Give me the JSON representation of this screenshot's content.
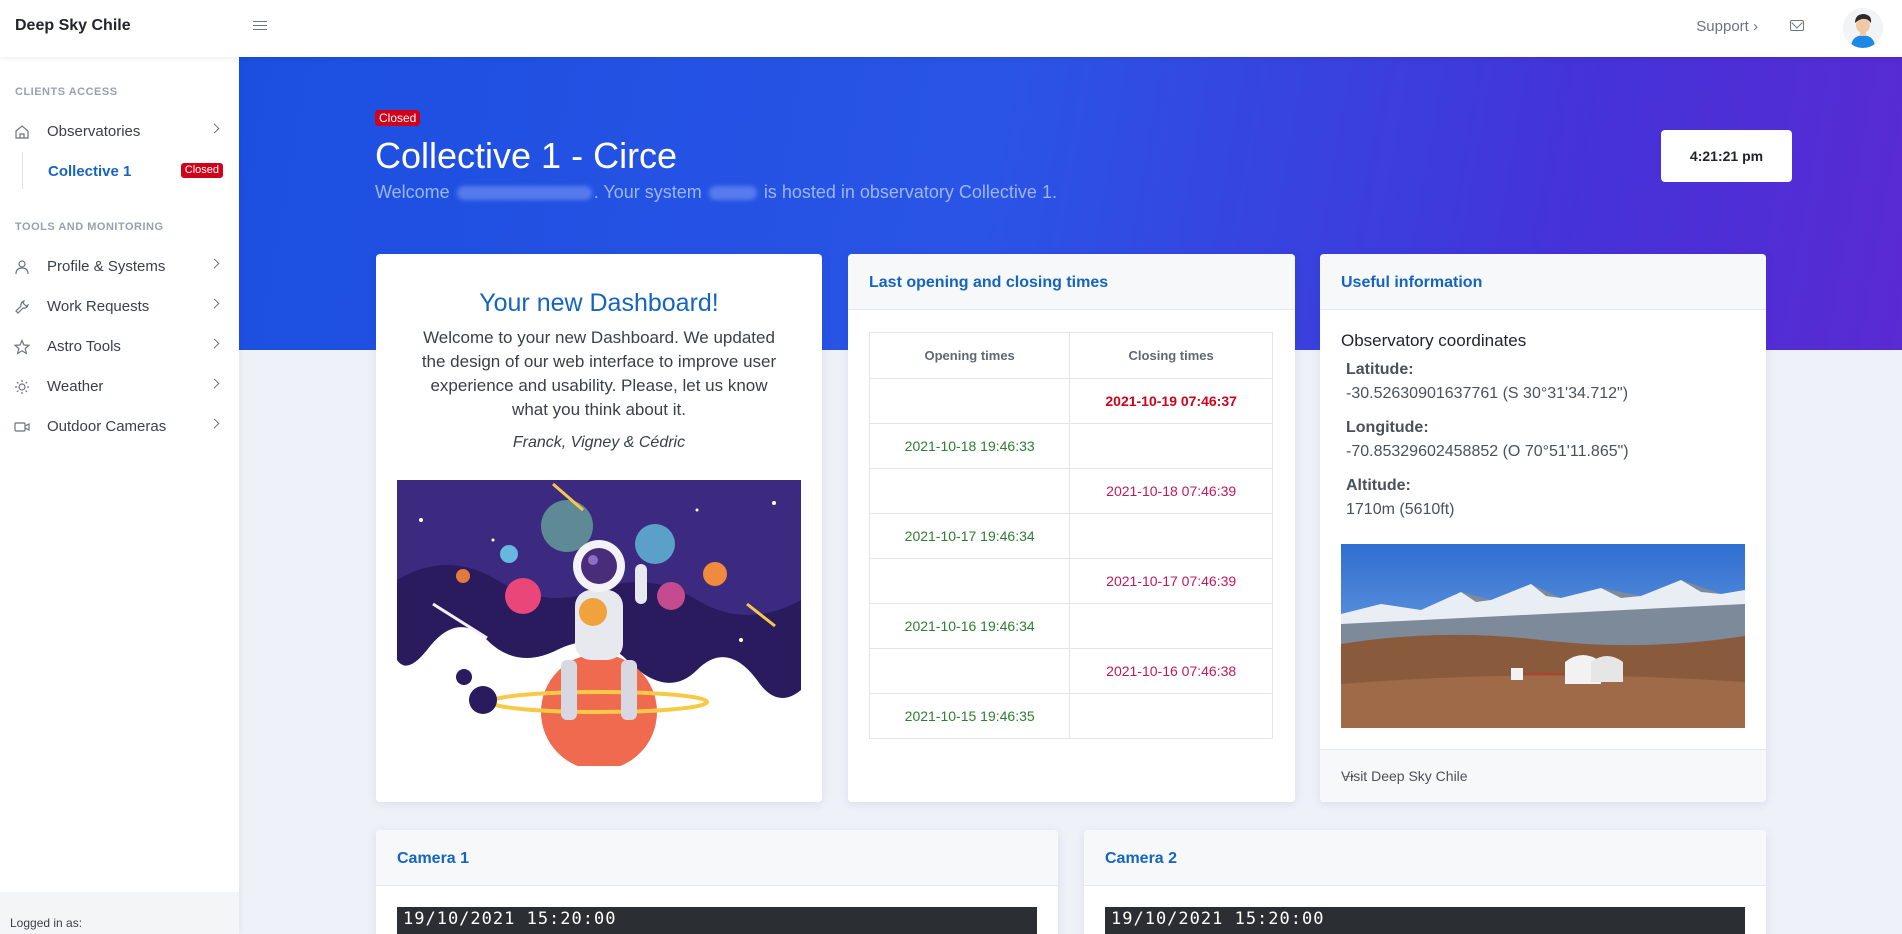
{
  "topbar": {
    "brand": "Deep Sky Chile",
    "support_label": "Support ›",
    "icons": {
      "menu": "hamburger-icon",
      "mail": "mail-icon",
      "avatar": "avatar"
    }
  },
  "sidebar": {
    "section1": "CLIENTS ACCESS",
    "section2": "TOOLS AND MONITORING",
    "items": [
      {
        "label": "Observatories",
        "icon": "home-icon"
      },
      {
        "label": "Profile & Systems",
        "icon": "user-icon"
      },
      {
        "label": "Work Requests",
        "icon": "wrench-icon"
      },
      {
        "label": "Astro Tools",
        "icon": "star-icon"
      },
      {
        "label": "Weather",
        "icon": "sun-icon"
      },
      {
        "label": "Outdoor Cameras",
        "icon": "video-icon"
      }
    ],
    "sub_item": {
      "label": "Collective 1",
      "badge": "Closed"
    },
    "logged_in": "Logged in as:"
  },
  "hero": {
    "badge": "Closed",
    "title": "Collective 1 - Circe",
    "welcome_a": "Welcome",
    "welcome_b": ". Your system",
    "welcome_c": "is hosted in observatory Collective 1.",
    "clock": "4:21:21 pm"
  },
  "dashboard": {
    "title": "Your new Dashboard!",
    "text": "Welcome to your new Dashboard. We updated the design of our web interface to improve user experience and usability. Please, let us know what you think about it.",
    "signature": "Franck, Vigney & Cédric"
  },
  "times": {
    "title": "Last opening and closing times",
    "col_open": "Opening times",
    "col_close": "Closing times",
    "rows": [
      {
        "open": "",
        "close": "2021-10-19 07:46:37"
      },
      {
        "open": "2021-10-18 19:46:33",
        "close": ""
      },
      {
        "open": "",
        "close": "2021-10-18 07:46:39"
      },
      {
        "open": "2021-10-17 19:46:34",
        "close": ""
      },
      {
        "open": "",
        "close": "2021-10-17 07:46:39"
      },
      {
        "open": "2021-10-16 19:46:34",
        "close": ""
      },
      {
        "open": "",
        "close": "2021-10-16 07:46:38"
      },
      {
        "open": "2021-10-15 19:46:35",
        "close": ""
      }
    ]
  },
  "info": {
    "title": "Useful information",
    "section": "Observatory coordinates",
    "lat_label": "Latitude:",
    "lat_value": "-30.52630901637761 (S 30°31'34.712\")",
    "lon_label": "Longitude:",
    "lon_value": "-70.85329602458852 (O 70°51'11.865\")",
    "alt_label": "Altitude:",
    "alt_value": "1710m (5610ft)",
    "footer_link": "Visit Deep Sky Chile",
    "footer_arrow": "→"
  },
  "cameras": [
    {
      "title": "Camera 1",
      "timestamp": "19/10/2021 15:20:00"
    },
    {
      "title": "Camera 2",
      "timestamp": "19/10/2021 15:20:00"
    }
  ],
  "colors": {
    "accent": "#1565c0",
    "closed": "#d0021b",
    "open": "#2e7d32"
  }
}
